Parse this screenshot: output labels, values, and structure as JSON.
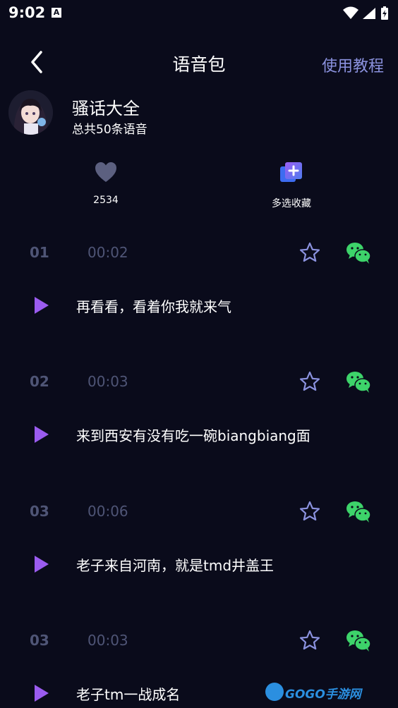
{
  "status_bar": {
    "time": "9:02",
    "notification_badge": "A"
  },
  "header": {
    "title": "语音包",
    "tutorial": "使用教程"
  },
  "profile": {
    "name": "骚话大全",
    "count_text": "总共50条语音"
  },
  "actions": [
    {
      "icon": "heart-icon",
      "label": "2534"
    },
    {
      "icon": "multi-select-add-icon",
      "label": "多选收藏"
    }
  ],
  "items": [
    {
      "number": "01",
      "duration": "00:02",
      "text": "再看看，看着你我就来气"
    },
    {
      "number": "02",
      "duration": "00:03",
      "text": "来到西安有没有吃一碗biangbiang面"
    },
    {
      "number": "03",
      "duration": "00:06",
      "text": "老子来自河南，就是tmd井盖王"
    },
    {
      "number": "03",
      "duration": "00:03",
      "text": "老子tm一战成名"
    }
  ],
  "watermark": {
    "text": "GOGO手游网"
  },
  "colors": {
    "background": "#0a0b1b",
    "accent": "#8b92df",
    "play": "#9b5cf0",
    "wechat": "#3dd36a",
    "muted": "#4f5576"
  }
}
